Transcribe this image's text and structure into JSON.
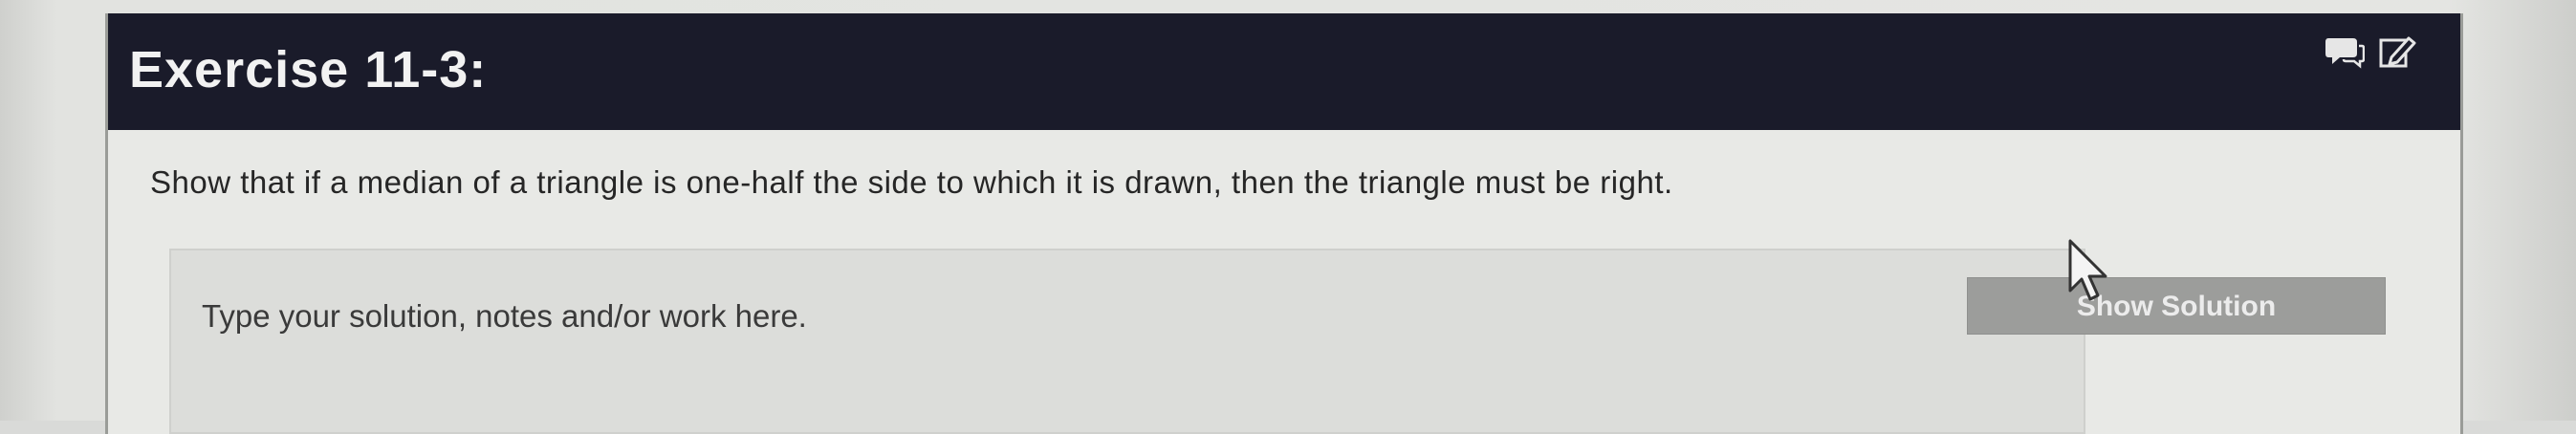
{
  "exercise": {
    "title": "Exercise 11-3:",
    "icons": [
      "comment-icon",
      "edit-icon"
    ]
  },
  "problem": {
    "prompt": "Show that if a median of a triangle is one-half the side to which it is drawn, then the triangle must be right."
  },
  "solution": {
    "placeholder": "Type your solution, notes and/or work here.",
    "value": "",
    "button_label": "Show Solution"
  },
  "colors": {
    "header_bg": "#1a1b2a",
    "header_text": "#f2f2f2",
    "button_bg": "#9c9d9b",
    "card_bg": "#e8e9e6"
  }
}
